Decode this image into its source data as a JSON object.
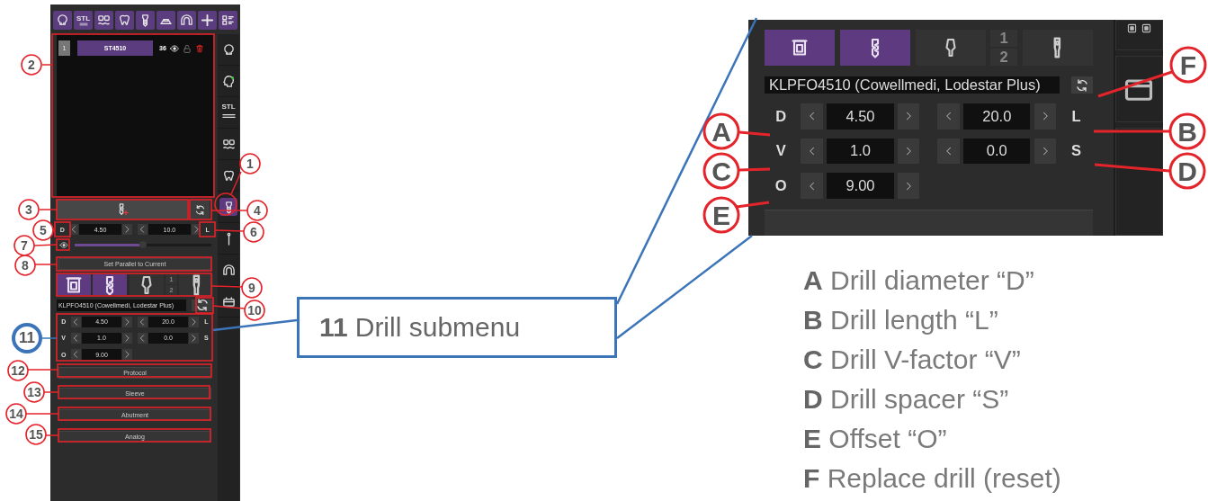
{
  "left_panel": {
    "toolbar": [
      {
        "kind": "skull"
      },
      {
        "kind": "stl",
        "label": "STL"
      },
      {
        "kind": "scan"
      },
      {
        "kind": "tooth"
      },
      {
        "kind": "implant"
      },
      {
        "kind": "dome"
      },
      {
        "kind": "arch"
      },
      {
        "kind": "plus"
      },
      {
        "kind": "grid"
      }
    ],
    "implant_list": [
      {
        "number": "1",
        "name": "ST4510",
        "tooth": "36"
      }
    ],
    "sidebar": [
      {
        "kind": "skull",
        "selected": false
      },
      {
        "kind": "head",
        "selected": false
      },
      {
        "kind": "stl",
        "label": "STL",
        "selected": false
      },
      {
        "kind": "scan",
        "selected": false
      },
      {
        "kind": "tooth",
        "selected": false
      },
      {
        "kind": "implant",
        "selected": true
      },
      {
        "kind": "pin",
        "selected": false
      },
      {
        "kind": "arch",
        "selected": false
      },
      {
        "kind": "box",
        "selected": false
      }
    ],
    "drill_size": {
      "diameter_label": "D",
      "diameter": "4.50",
      "length": "10.0",
      "length_label": "L"
    },
    "view_slider": {
      "level": 0.5
    },
    "parallel_button": "Set Parallel to Current",
    "component_tabs": [
      {
        "kind": "sleeve",
        "selected": true
      },
      {
        "kind": "drill",
        "selected": true
      },
      {
        "kind": "abutment",
        "selected": false
      },
      {
        "kind": "counter",
        "numbers": [
          "1",
          "2"
        ],
        "selected": false
      },
      {
        "kind": "analog",
        "selected": false
      }
    ],
    "drill_name": "KLPFO4510 (Cowellmedi, Lodestar Plus)",
    "drill_params": [
      {
        "label": "D",
        "value": "4.50",
        "value_2": "20.0",
        "label_2": "L"
      },
      {
        "label": "V",
        "value": "1.0",
        "value_2": "0.0",
        "label_2": "S"
      },
      {
        "label": "O",
        "value": "9.00"
      }
    ],
    "buttons": [
      "Protocol",
      "Sleeve",
      "Abutment",
      "Analog"
    ]
  },
  "callouts": [
    {
      "number": "2",
      "color": "#e3242b"
    },
    {
      "number": "1",
      "color": "#e3242b"
    },
    {
      "number": "3",
      "color": "#e3242b"
    },
    {
      "number": "4",
      "color": "#e3242b"
    },
    {
      "number": "5",
      "color": "#e3242b"
    },
    {
      "number": "6",
      "color": "#e3242b"
    },
    {
      "number": "7",
      "color": "#e3242b"
    },
    {
      "number": "8",
      "color": "#e3242b"
    },
    {
      "number": "9",
      "color": "#e3242b"
    },
    {
      "number": "10",
      "color": "#e3242b"
    },
    {
      "number": "11",
      "color": "#3b74b9"
    },
    {
      "number": "12",
      "color": "#e3242b"
    },
    {
      "number": "13",
      "color": "#e3242b"
    },
    {
      "number": "14",
      "color": "#e3242b"
    },
    {
      "number": "15",
      "color": "#e3242b"
    }
  ],
  "submenu_callout": {
    "number": "11",
    "title": "Drill submenu"
  },
  "detail_view": {
    "component_tabs": [
      {
        "kind": "sleeve",
        "selected": true
      },
      {
        "kind": "drill",
        "selected": true
      },
      {
        "kind": "abutment",
        "selected": false
      },
      {
        "kind": "counter",
        "numbers": [
          "1",
          "2"
        ],
        "selected": false
      },
      {
        "kind": "analog",
        "selected": false
      }
    ],
    "drill_name": "KLPFO4510 (Cowellmedi, Lodestar Plus)",
    "drill_params": [
      {
        "label": "D",
        "value": "4.50",
        "value_2": "20.0",
        "label_2": "L"
      },
      {
        "label": "V",
        "value": "1.0",
        "value_2": "0.0",
        "label_2": "S"
      },
      {
        "label": "O",
        "value": "9.00"
      }
    ],
    "markers": [
      {
        "letter": "F"
      },
      {
        "letter": "A"
      },
      {
        "letter": "B"
      },
      {
        "letter": "C"
      },
      {
        "letter": "D"
      },
      {
        "letter": "E"
      }
    ]
  },
  "legend": [
    {
      "letter": "A",
      "text": "Drill diameter “D”"
    },
    {
      "letter": "B",
      "text": "Drill length “L”"
    },
    {
      "letter": "C",
      "text": "Drill V-factor “V”"
    },
    {
      "letter": "D",
      "text": "Drill spacer “S”"
    },
    {
      "letter": "E",
      "text": "Offset “O”"
    },
    {
      "letter": "F",
      "text": "Replace drill (reset)"
    }
  ]
}
